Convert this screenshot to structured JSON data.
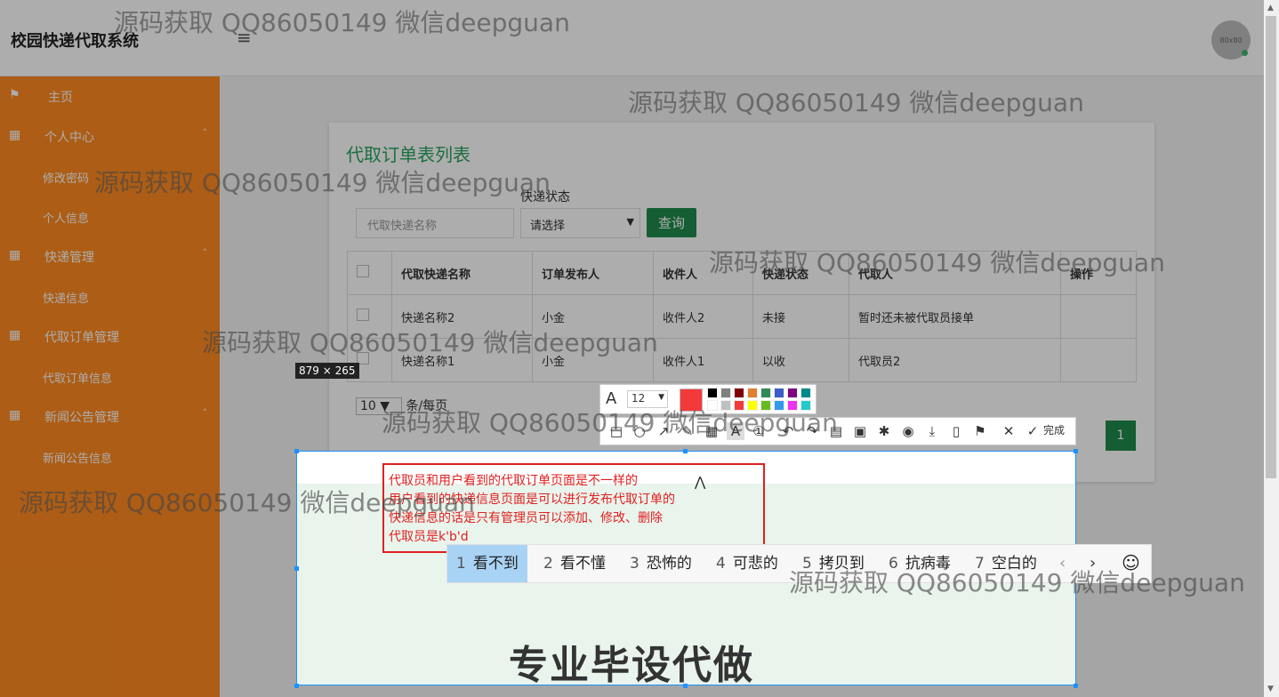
{
  "app": {
    "title": "校园快递代取系统",
    "menu_icon": "hamburger-icon",
    "avatar_text": "80x80"
  },
  "sidebar": {
    "groups": [
      {
        "label": "主页",
        "icon": "flag-icon",
        "children": []
      },
      {
        "label": "个人中心",
        "icon": "grid-icon",
        "children": [
          "修改密码",
          "个人信息"
        ]
      },
      {
        "label": "快递管理",
        "icon": "grid-icon",
        "children": [
          "快递信息"
        ]
      },
      {
        "label": "代取订单管理",
        "icon": "grid-icon",
        "children": [
          "代取订单信息"
        ]
      },
      {
        "label": "新闻公告管理",
        "icon": "grid-icon",
        "children": [
          "新闻公告信息"
        ]
      }
    ]
  },
  "panel": {
    "title": "代取订单表列表",
    "search_placeholder": "代取快递名称",
    "status_label": "快递状态",
    "status_value": "请选择",
    "query_label": "查询",
    "columns": [
      "代取快递名称",
      "订单发布人",
      "收件人",
      "快递状态",
      "代取人",
      "操作"
    ],
    "rows": [
      [
        "快递名称2",
        "小金",
        "收件人2",
        "未接",
        "暂时还未被代取员接单",
        ""
      ],
      [
        "快递名称1",
        "小金",
        "收件人1",
        "以收",
        "代取员2",
        ""
      ]
    ],
    "per_page_value": "10",
    "per_page_suffix": "条/每页",
    "current_page": "1"
  },
  "capture": {
    "size_label": "879 × 265",
    "annotation_lines": [
      "代取员和用户看到的代取订单页面是不一样的",
      "用户看到的快递信息页面是可以进行发布代取订单的",
      "快递信息的话是只有管理员可以添加、修改、删除",
      "代取员是k'b'd"
    ],
    "big_caption": "专业毕设代做",
    "text_toolbar": {
      "font_size": "12",
      "current_color": "#f33a3a",
      "palette": [
        "#000000",
        "#808080",
        "#800000",
        "#e08030",
        "#2e8b57",
        "#3b5ec9",
        "#800080",
        "#008b8b",
        "#ffffff",
        "#c0c0c0",
        "#f33a3a",
        "#ffff00",
        "#66bb22",
        "#3399ee",
        "#ee33ee",
        "#22cccc"
      ]
    },
    "tools": [
      "rectangle-icon",
      "ellipse-icon",
      "arrow-icon",
      "pen-icon",
      "mosaic-icon",
      "text-icon",
      "number-icon",
      "undo-icon",
      "redo-icon",
      "translate-icon",
      "ocr-icon",
      "pin-icon",
      "record-icon",
      "download-icon",
      "save-icon",
      "bookmark-icon",
      "cancel-icon",
      "check-icon"
    ],
    "done_label": "完成"
  },
  "ime": {
    "candidates": [
      {
        "num": "1",
        "text": "看不到"
      },
      {
        "num": "2",
        "text": "看不懂"
      },
      {
        "num": "3",
        "text": "恐怖的"
      },
      {
        "num": "4",
        "text": "可悲的"
      },
      {
        "num": "5",
        "text": "拷贝到"
      },
      {
        "num": "6",
        "text": "抗病毒"
      },
      {
        "num": "7",
        "text": "空白的"
      }
    ]
  },
  "watermark": "源码获取 QQ86050149 微信deepguan"
}
